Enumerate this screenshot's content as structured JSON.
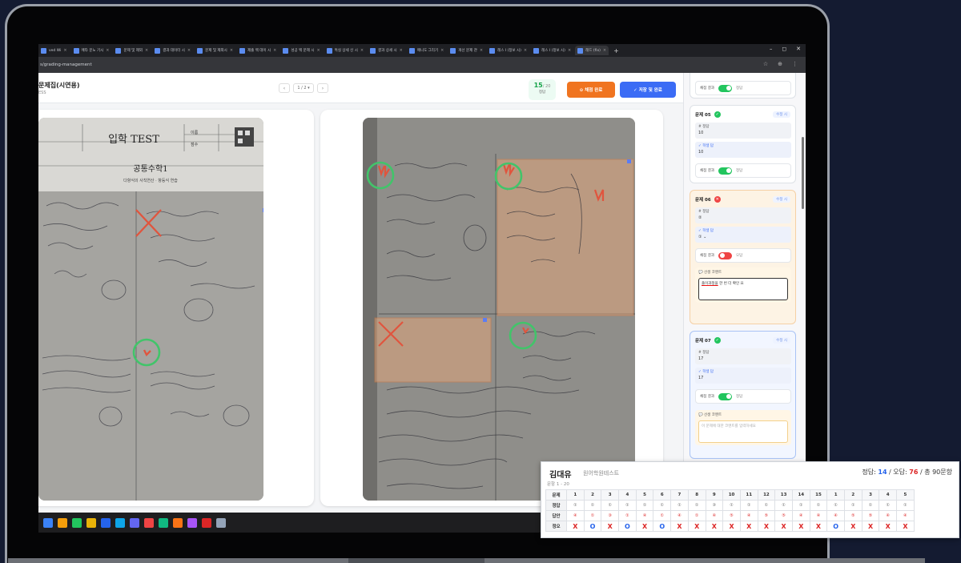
{
  "browser": {
    "tabs": [
      "ved Wi",
      "메타 문노 기시",
      "문제 및 제외",
      "결과 데이터 시",
      "문제 및 제외시",
      "제출 백 데이 시",
      "성공 백 문제 시",
      "특실 상세 신 시",
      "결과 상세 시",
      "매니도 그리기",
      "개선 문제 관",
      "레스 I (정보 시)",
      "레스 I (정보 시)",
      "래드 (fix)"
    ],
    "active_tab_index": 13,
    "new_tab": "+",
    "url": "s/grading-management",
    "window_controls": [
      "–",
      "◻",
      "✕"
    ]
  },
  "app": {
    "title": "문제집(시연용)",
    "subtitle": "ESS",
    "pager": {
      "prev": "‹",
      "value": "1 / 2 ▾",
      "next": "›"
    },
    "score": {
      "value": "15",
      "total": "/ 20",
      "label": "정답"
    },
    "btn_auto": "⊙ 채점 완료",
    "btn_save": "✓ 저장 및 완료"
  },
  "page1": {
    "header_title": "입학 TEST",
    "subject": "공통수학1",
    "sub_label": "다항식의 사칙연산 · 항등식 연습",
    "name_label": "이름",
    "score_label": "점수"
  },
  "sidebar": {
    "top_switch": {
      "label": "채점 결과",
      "value": "정답"
    },
    "cards": [
      {
        "title": "문제 05",
        "status": "correct",
        "tag": "수정 시",
        "correct_label": "# 정답",
        "correct_value": "10",
        "answer_label": "✓ 학생 답",
        "answer_value": "10",
        "switch_label": "채점 결과",
        "switch_value": "정답"
      },
      {
        "title": "문제 06",
        "status": "wrong",
        "tag": "수정 시",
        "correct_label": "# 정답",
        "correct_value": "②",
        "answer_label": "✓ 학생 답",
        "answer_value": "①",
        "switch_label": "채점 결과",
        "switch_value": "오답",
        "comment_label": "💬 선생 코멘트",
        "comment_text": "풀이과정을 한 번 더 확인 요",
        "comment_ul": "풀이과정을"
      },
      {
        "title": "문제 07",
        "status": "correct",
        "tag": "수정 시",
        "correct_label": "# 정답",
        "correct_value": "17",
        "answer_label": "✓ 학생 답",
        "answer_value": "17",
        "switch_label": "채점 결과",
        "switch_value": "정답",
        "comment_label": "💬 선생 코멘트",
        "comment_placeholder": "이 문제에 대한 코멘트를 입력하세요"
      }
    ]
  },
  "results": {
    "student": "김대유",
    "test": "원어학원테스트",
    "score_prefix": "정답: ",
    "correct": "14",
    "sep1": " / 오답: ",
    "wrong": "76",
    "total": " / 총 90문항",
    "range": "문항 1 - 20",
    "row_labels": [
      "문제",
      "정답",
      "답안",
      "정오"
    ],
    "numbers": [
      "1",
      "2",
      "3",
      "4",
      "5",
      "6",
      "7",
      "8",
      "9",
      "10",
      "11",
      "12",
      "13",
      "14",
      "15",
      "1",
      "2",
      "3",
      "4",
      "5"
    ],
    "answers": [
      "①",
      "①",
      "①",
      "①",
      "①",
      "①",
      "①",
      "①",
      "③",
      "①",
      "①",
      "①",
      "①",
      "①",
      "①",
      "①",
      "①",
      "①",
      "①",
      "①"
    ],
    "responses": [
      "④",
      "①",
      "③",
      "①",
      "④",
      "①",
      "④",
      "①",
      "④",
      "⑤",
      "④",
      "⑤",
      "⑤",
      "④",
      "④",
      "④",
      "⑤",
      "⑤",
      "④",
      "④"
    ],
    "marks": [
      "X",
      "O",
      "X",
      "O",
      "X",
      "O",
      "X",
      "X",
      "X",
      "X",
      "X",
      "X",
      "X",
      "X",
      "X",
      "O",
      "X",
      "X",
      "X",
      "X"
    ]
  }
}
